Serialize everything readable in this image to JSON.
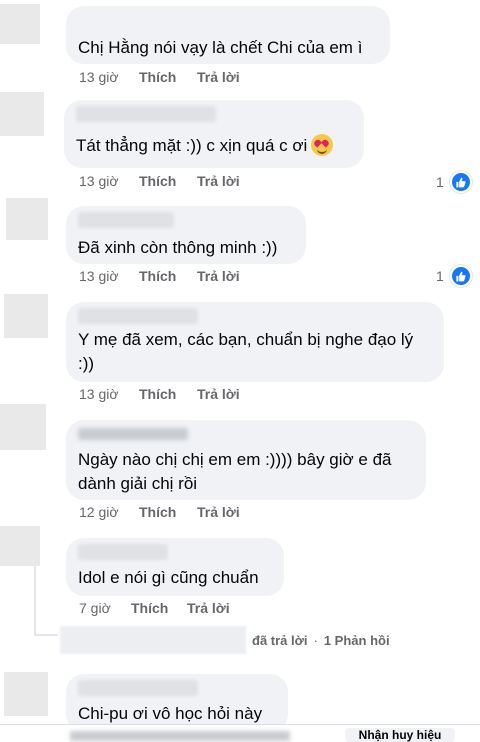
{
  "comments": [
    {
      "text": "Chị Hằng nói vạy là chết Chi của em ì",
      "time": "13 giờ",
      "like": "Thích",
      "reply": "Trả lời"
    },
    {
      "text": "Tát thẳng mặt :)) c xịn quá c ơi",
      "time": "13 giờ",
      "like": "Thích",
      "reply": "Trả lời",
      "reactions": "1",
      "emoji": "heart-eyes"
    },
    {
      "text": "Đã xinh còn thông minh :))",
      "time": "13 giờ",
      "like": "Thích",
      "reply": "Trả lời",
      "reactions": "1"
    },
    {
      "text": "Y mẹ đã xem, các bạn, chuẩn bị nghe đạo lý :))",
      "time": "13 giờ",
      "like": "Thích",
      "reply": "Trả lời"
    },
    {
      "text": "Ngày nào chị chị em em :)))) bây giờ e đã dành giải chị rồi",
      "time": "12 giờ",
      "like": "Thích",
      "reply": "Trả lời"
    },
    {
      "text": "Idol e nói gì cũng chuẩn",
      "time": "7 giờ",
      "like": "Thích",
      "reply": "Trả lời"
    },
    {
      "text": "Chi-pu ơi vô học hỏi này"
    }
  ],
  "replies_summary": {
    "replied": "đã trả lời",
    "dot": "·",
    "count": "1 Phản hồi"
  },
  "bottom": {
    "button": "Nhận huy hiệu"
  },
  "colors": {
    "bubble": "#f0f2f5",
    "meta": "#65676b",
    "like_blue": "#1877f2"
  }
}
